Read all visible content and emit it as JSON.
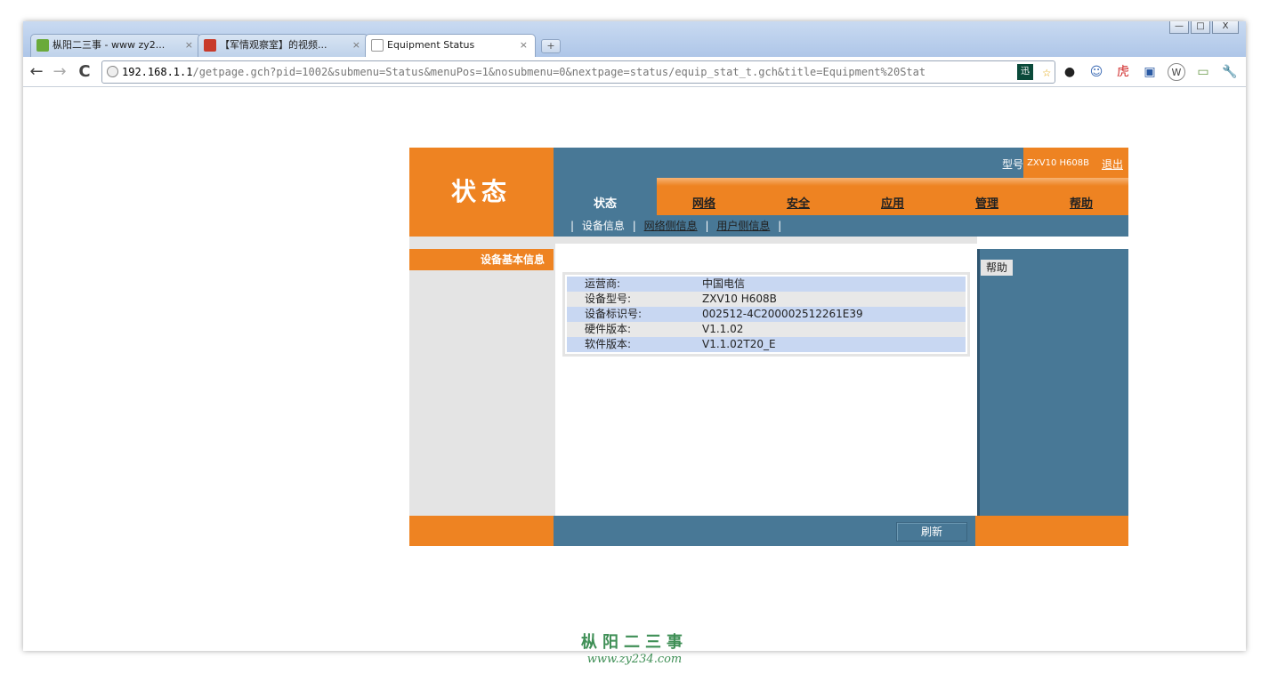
{
  "browser": {
    "tabs": [
      {
        "label": "枞阳二三事 - www zy2...",
        "icon_color": "#6aaa3a",
        "active": false
      },
      {
        "label": "【军情观察室】的视频...",
        "icon_color": "#c83a2a",
        "active": false
      },
      {
        "label": "Equipment Status",
        "icon_color": "#ffffff",
        "active": true
      }
    ],
    "close_symbol": "×",
    "new_tab_symbol": "+",
    "nav": {
      "back": "←",
      "forward": "→",
      "reload": "C"
    },
    "url_host": "192.168.1.1",
    "url_path": "/getpage.gch?pid=1002&submenu=Status&menuPos=1&nosubmenu=0&nextpage=status/equip_stat_t.gch&title=Equipment%20Stat",
    "ext_badge": "迅",
    "star": "☆",
    "extension_icons": [
      "●",
      "☺",
      "虎",
      "▣",
      "W",
      "▭",
      "🔧"
    ],
    "window_controls": {
      "minimize": "—",
      "maximize": "□",
      "close": "X"
    }
  },
  "router": {
    "logo_text": "状态",
    "model_label": "型号",
    "model_value": "ZXV10 H608B",
    "logout_label": "退出",
    "nav": [
      {
        "label": "状态",
        "active": true
      },
      {
        "label": "网络",
        "active": false
      },
      {
        "label": "安全",
        "active": false
      },
      {
        "label": "应用",
        "active": false
      },
      {
        "label": "管理",
        "active": false
      },
      {
        "label": "帮助",
        "active": false
      }
    ],
    "subnav": [
      {
        "label": "设备信息",
        "active": true
      },
      {
        "label": "网络侧信息",
        "active": false
      },
      {
        "label": "用户侧信息",
        "active": false
      }
    ],
    "left_heading": "设备基本信息",
    "info": [
      {
        "key": "运营商:",
        "value": "中国电信"
      },
      {
        "key": "设备型号:",
        "value": "ZXV10 H608B"
      },
      {
        "key": "设备标识号:",
        "value": "002512-4C200002512261E39"
      },
      {
        "key": "硬件版本:",
        "value": "V1.1.02"
      },
      {
        "key": "软件版本:",
        "value": "V1.1.02T20_E"
      }
    ],
    "help_button": "帮助",
    "refresh_button": "刷新",
    "colors": {
      "orange": "#ee8322",
      "blue": "#487896"
    }
  },
  "watermark": {
    "line1": "枞阳二三事",
    "line2": "www.zy234.com"
  }
}
